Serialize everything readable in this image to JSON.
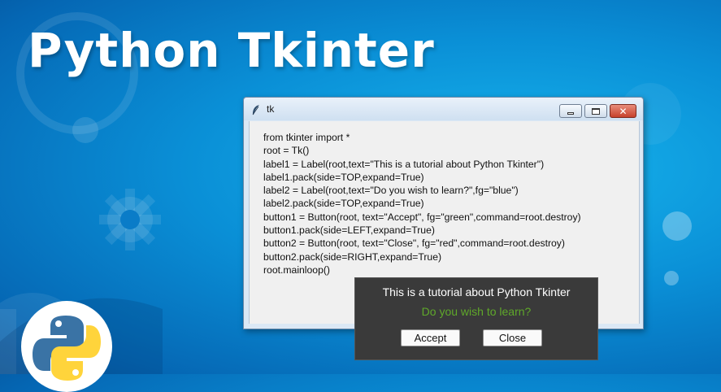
{
  "banner": {
    "title": "Python Tkinter"
  },
  "tk_window": {
    "title": "tk",
    "controls": {
      "minimize_icon": "minimize-icon",
      "maximize_icon": "maximize-icon",
      "close_icon": "close-icon",
      "close_glyph": "✕"
    },
    "code_lines": [
      "from tkinter import *",
      "root = Tk()",
      "label1 = Label(root,text=\"This is a tutorial about Python Tkinter\")",
      "label1.pack(side=TOP,expand=True)",
      "label2 = Label(root,text=\"Do you wish to learn?\",fg=\"blue\")",
      "label2.pack(side=TOP,expand=True)",
      "button1 = Button(root, text=\"Accept\", fg=\"green\",command=root.destroy)",
      "button1.pack(side=LEFT,expand=True)",
      "button2 = Button(root, text=\"Close\", fg=\"red\",command=root.destroy)",
      "button2.pack(side=RIGHT,expand=True)",
      "root.mainloop()"
    ]
  },
  "demo_window": {
    "label1": "This is a tutorial about Python Tkinter",
    "label2": "Do you wish to learn?",
    "accept_label": "Accept",
    "close_label": "Close"
  },
  "colors": {
    "background": "#0a8fd6",
    "title_text": "#ffffff",
    "popup_bg": "#3a3a3a",
    "label2_text": "#5fa82a",
    "python_blue": "#3a73a5",
    "python_yellow": "#ffd43b"
  }
}
